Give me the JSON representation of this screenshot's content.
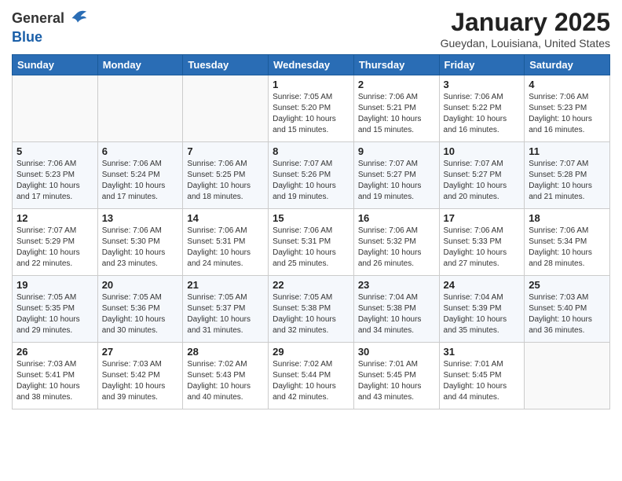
{
  "header": {
    "logo_line1": "General",
    "logo_line2": "Blue",
    "month": "January 2025",
    "location": "Gueydan, Louisiana, United States"
  },
  "weekdays": [
    "Sunday",
    "Monday",
    "Tuesday",
    "Wednesday",
    "Thursday",
    "Friday",
    "Saturday"
  ],
  "weeks": [
    [
      {
        "day": "",
        "info": ""
      },
      {
        "day": "",
        "info": ""
      },
      {
        "day": "",
        "info": ""
      },
      {
        "day": "1",
        "info": "Sunrise: 7:05 AM\nSunset: 5:20 PM\nDaylight: 10 hours\nand 15 minutes."
      },
      {
        "day": "2",
        "info": "Sunrise: 7:06 AM\nSunset: 5:21 PM\nDaylight: 10 hours\nand 15 minutes."
      },
      {
        "day": "3",
        "info": "Sunrise: 7:06 AM\nSunset: 5:22 PM\nDaylight: 10 hours\nand 16 minutes."
      },
      {
        "day": "4",
        "info": "Sunrise: 7:06 AM\nSunset: 5:23 PM\nDaylight: 10 hours\nand 16 minutes."
      }
    ],
    [
      {
        "day": "5",
        "info": "Sunrise: 7:06 AM\nSunset: 5:23 PM\nDaylight: 10 hours\nand 17 minutes."
      },
      {
        "day": "6",
        "info": "Sunrise: 7:06 AM\nSunset: 5:24 PM\nDaylight: 10 hours\nand 17 minutes."
      },
      {
        "day": "7",
        "info": "Sunrise: 7:06 AM\nSunset: 5:25 PM\nDaylight: 10 hours\nand 18 minutes."
      },
      {
        "day": "8",
        "info": "Sunrise: 7:07 AM\nSunset: 5:26 PM\nDaylight: 10 hours\nand 19 minutes."
      },
      {
        "day": "9",
        "info": "Sunrise: 7:07 AM\nSunset: 5:27 PM\nDaylight: 10 hours\nand 19 minutes."
      },
      {
        "day": "10",
        "info": "Sunrise: 7:07 AM\nSunset: 5:27 PM\nDaylight: 10 hours\nand 20 minutes."
      },
      {
        "day": "11",
        "info": "Sunrise: 7:07 AM\nSunset: 5:28 PM\nDaylight: 10 hours\nand 21 minutes."
      }
    ],
    [
      {
        "day": "12",
        "info": "Sunrise: 7:07 AM\nSunset: 5:29 PM\nDaylight: 10 hours\nand 22 minutes."
      },
      {
        "day": "13",
        "info": "Sunrise: 7:06 AM\nSunset: 5:30 PM\nDaylight: 10 hours\nand 23 minutes."
      },
      {
        "day": "14",
        "info": "Sunrise: 7:06 AM\nSunset: 5:31 PM\nDaylight: 10 hours\nand 24 minutes."
      },
      {
        "day": "15",
        "info": "Sunrise: 7:06 AM\nSunset: 5:31 PM\nDaylight: 10 hours\nand 25 minutes."
      },
      {
        "day": "16",
        "info": "Sunrise: 7:06 AM\nSunset: 5:32 PM\nDaylight: 10 hours\nand 26 minutes."
      },
      {
        "day": "17",
        "info": "Sunrise: 7:06 AM\nSunset: 5:33 PM\nDaylight: 10 hours\nand 27 minutes."
      },
      {
        "day": "18",
        "info": "Sunrise: 7:06 AM\nSunset: 5:34 PM\nDaylight: 10 hours\nand 28 minutes."
      }
    ],
    [
      {
        "day": "19",
        "info": "Sunrise: 7:05 AM\nSunset: 5:35 PM\nDaylight: 10 hours\nand 29 minutes."
      },
      {
        "day": "20",
        "info": "Sunrise: 7:05 AM\nSunset: 5:36 PM\nDaylight: 10 hours\nand 30 minutes."
      },
      {
        "day": "21",
        "info": "Sunrise: 7:05 AM\nSunset: 5:37 PM\nDaylight: 10 hours\nand 31 minutes."
      },
      {
        "day": "22",
        "info": "Sunrise: 7:05 AM\nSunset: 5:38 PM\nDaylight: 10 hours\nand 32 minutes."
      },
      {
        "day": "23",
        "info": "Sunrise: 7:04 AM\nSunset: 5:38 PM\nDaylight: 10 hours\nand 34 minutes."
      },
      {
        "day": "24",
        "info": "Sunrise: 7:04 AM\nSunset: 5:39 PM\nDaylight: 10 hours\nand 35 minutes."
      },
      {
        "day": "25",
        "info": "Sunrise: 7:03 AM\nSunset: 5:40 PM\nDaylight: 10 hours\nand 36 minutes."
      }
    ],
    [
      {
        "day": "26",
        "info": "Sunrise: 7:03 AM\nSunset: 5:41 PM\nDaylight: 10 hours\nand 38 minutes."
      },
      {
        "day": "27",
        "info": "Sunrise: 7:03 AM\nSunset: 5:42 PM\nDaylight: 10 hours\nand 39 minutes."
      },
      {
        "day": "28",
        "info": "Sunrise: 7:02 AM\nSunset: 5:43 PM\nDaylight: 10 hours\nand 40 minutes."
      },
      {
        "day": "29",
        "info": "Sunrise: 7:02 AM\nSunset: 5:44 PM\nDaylight: 10 hours\nand 42 minutes."
      },
      {
        "day": "30",
        "info": "Sunrise: 7:01 AM\nSunset: 5:45 PM\nDaylight: 10 hours\nand 43 minutes."
      },
      {
        "day": "31",
        "info": "Sunrise: 7:01 AM\nSunset: 5:45 PM\nDaylight: 10 hours\nand 44 minutes."
      },
      {
        "day": "",
        "info": ""
      }
    ]
  ]
}
